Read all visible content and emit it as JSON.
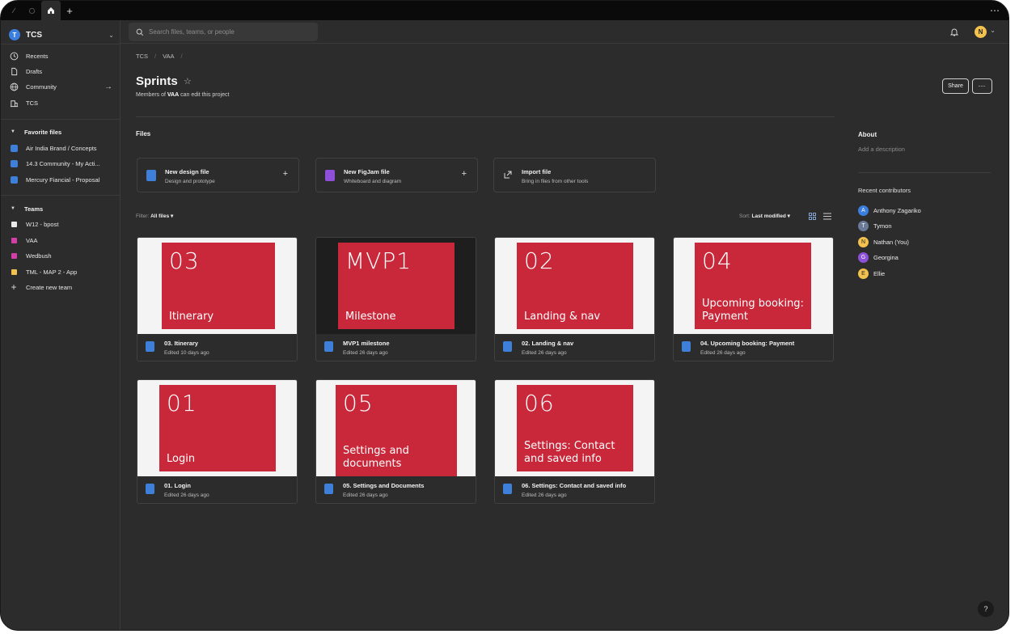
{
  "tabbar": {
    "more": "⋯"
  },
  "sidebar": {
    "org_initial": "T",
    "org_name": "TCS",
    "nav": [
      {
        "label": "Recents"
      },
      {
        "label": "Drafts"
      },
      {
        "label": "Community"
      },
      {
        "label": "TCS"
      }
    ],
    "favorites_heading": "Favorite files",
    "favorites": [
      {
        "label": "Air India Brand / Concepts"
      },
      {
        "label": "14.3 Community - My Acti..."
      },
      {
        "label": "Mercury Fiancial - Proposal"
      }
    ],
    "teams_heading": "Teams",
    "teams": [
      {
        "label": "W12 - bpost",
        "color": "#e9e9e9"
      },
      {
        "label": "VAA",
        "color": "#d23fa8"
      },
      {
        "label": "Wedbush",
        "color": "#d23fa8"
      },
      {
        "label": "TML - MAP 2 - App",
        "color": "#f2c14e"
      }
    ],
    "create_team": "Create new team"
  },
  "topbar": {
    "search_placeholder": "Search files, teams, or people",
    "user_initial": "N"
  },
  "breadcrumb": [
    "TCS",
    "VAA"
  ],
  "project": {
    "title": "Sprints",
    "subtitle_pre": "Members of ",
    "subtitle_team": "VAA",
    "subtitle_post": " can edit this project",
    "share_label": "Share"
  },
  "files_heading": "Files",
  "new_files": [
    {
      "title": "New design file",
      "desc": "Design and prototype",
      "color": "#3d7fd9",
      "plus": "+"
    },
    {
      "title": "New FigJam file",
      "desc": "Whiteboard and diagram",
      "color": "#8e4fd9",
      "plus": "+"
    },
    {
      "title": "Import file",
      "desc": "Bring in files from other tools",
      "color": "",
      "plus": ""
    }
  ],
  "filter": {
    "label": "Filter:",
    "value": "All files ▾"
  },
  "sort": {
    "label": "Sort:",
    "value": "Last modified ▾"
  },
  "files": [
    {
      "name": "03. Itinerary",
      "edited": "Edited 10 days ago",
      "thumb_big": "03",
      "thumb_small": "Itinerary"
    },
    {
      "name": "MVP1 milestone",
      "edited": "Edited 26 days ago",
      "thumb_big": "MVP1",
      "thumb_small": "Milestone"
    },
    {
      "name": "02. Landing & nav",
      "edited": "Edited 26 days ago",
      "thumb_big": "02",
      "thumb_small": "Landing & nav"
    },
    {
      "name": "04. Upcoming booking: Payment",
      "edited": "Edited 26 days ago",
      "thumb_big": "04",
      "thumb_small": "Upcoming booking: Payment"
    },
    {
      "name": "01. Login",
      "edited": "Edited 26 days ago",
      "thumb_big": "01",
      "thumb_small": "Login"
    },
    {
      "name": "05. Settings and Documents",
      "edited": "Edited 26 days ago",
      "thumb_big": "05",
      "thumb_small": "Settings and documents"
    },
    {
      "name": "06. Settings: Contact and saved info",
      "edited": "Edited 26 days ago",
      "thumb_big": "06",
      "thumb_small": "Settings: Contact and saved info"
    }
  ],
  "about": {
    "heading": "About",
    "description_placeholder": "Add a description",
    "contributors_heading": "Recent contributors",
    "contributors": [
      {
        "initial": "A",
        "name": "Anthony Zagariko",
        "color": "#3a7ee0"
      },
      {
        "initial": "T",
        "name": "Tymon",
        "color": "#6b7a99"
      },
      {
        "initial": "N",
        "name": "Nathan (You)",
        "color": "#f2c14e"
      },
      {
        "initial": "G",
        "name": "Georgina",
        "color": "#8e4fd9"
      },
      {
        "initial": "E",
        "name": "Ellie",
        "color": "#f2c14e"
      }
    ]
  },
  "help_label": "?"
}
